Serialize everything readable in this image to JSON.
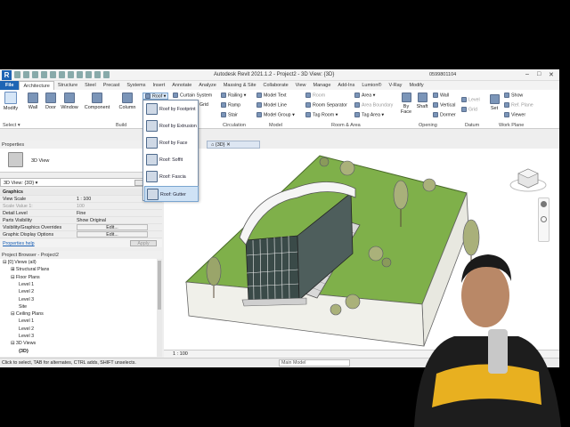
{
  "app": {
    "logo": "R",
    "title": "Autodesk Revit 2021.1.2 - Project2 - 3D View: {3D}",
    "user": "0599801104",
    "window_buttons": [
      "–",
      "□",
      "✕"
    ]
  },
  "tabs": [
    "File",
    "Architecture",
    "Structure",
    "Steel",
    "Precast",
    "Systems",
    "Insert",
    "Annotate",
    "Analyze",
    "Massing & Site",
    "Collaborate",
    "View",
    "Manage",
    "Add-Ins",
    "Lumion®",
    "V-Ray",
    "Modify"
  ],
  "active_tab": "Architecture",
  "ribbon": {
    "modify": "Modify",
    "select": "Select ▾",
    "build_buttons": [
      "Wall",
      "Door",
      "Window",
      "Component",
      "Column"
    ],
    "build_label": "Build",
    "roof": "Roof",
    "curtain_system": "Curtain System",
    "grid": "Grid",
    "railing": "Railing",
    "ramp": "Ramp",
    "stair": "Stair",
    "circulation_label": "Circulation",
    "model_text": "Model Text",
    "model_line": "Model Line",
    "model_group": "Model Group",
    "model_label": "Model",
    "room": "Room",
    "room_separator": "Room Separator",
    "tag_room": "Tag Room",
    "area": "Area",
    "area_boundary": "Area Boundary",
    "tag_area": "Tag Area",
    "room_area_label": "Room & Area",
    "by_face": "By\nFace",
    "shaft": "Shaft",
    "wall_opening": "Wall",
    "vertical": "Vertical",
    "dormer": "Dormer",
    "opening_label": "Opening",
    "level": "Level",
    "grid2": "Grid",
    "datum_label": "Datum",
    "set": "Set",
    "show": "Show",
    "ref_plane": "Ref. Plane",
    "viewer": "Viewer",
    "work_plane_label": "Work Plane"
  },
  "roof_menu": [
    "Roof by Footprint",
    "Roof by Extrusion",
    "Roof by Face",
    "Roof: Soffit",
    "Roof: Fascia",
    "Roof: Gutter"
  ],
  "properties": {
    "header": "Properties",
    "type_name": "3D View",
    "selector": "3D View: {3D}",
    "edit_type": "",
    "section": "Graphics",
    "rows": [
      {
        "k": "View Scale",
        "v": "1 : 100"
      },
      {
        "k": "Scale Value  1:",
        "v": "100"
      },
      {
        "k": "Detail Level",
        "v": "Fine"
      },
      {
        "k": "Parts Visibility",
        "v": "Show Original"
      },
      {
        "k": "Visibility/Graphics Overrides",
        "v": "Edit..."
      },
      {
        "k": "Graphic Display Options",
        "v": "Edit..."
      }
    ],
    "help_link": "Properties help",
    "apply": "Apply"
  },
  "browser": {
    "header": "Project Browser - Project2",
    "nodes": [
      {
        "t": "⊟ [0] Views (all)",
        "d": 0
      },
      {
        "t": "⊞ Structural Plans",
        "d": 1
      },
      {
        "t": "⊟ Floor Plans",
        "d": 1
      },
      {
        "t": "Level 1",
        "d": 2
      },
      {
        "t": "Level 2",
        "d": 2
      },
      {
        "t": "Level 3",
        "d": 2
      },
      {
        "t": "Site",
        "d": 2
      },
      {
        "t": "⊟ Ceiling Plans",
        "d": 1
      },
      {
        "t": "Level 1",
        "d": 2
      },
      {
        "t": "Level 2",
        "d": 2
      },
      {
        "t": "Level 3",
        "d": 2
      },
      {
        "t": "⊟ 3D Views",
        "d": 1
      },
      {
        "t": "{3D}",
        "d": 2
      }
    ]
  },
  "view": {
    "tab_label": "{3D}",
    "scale": "1 : 100"
  },
  "status": {
    "message": "Click to select, TAB for alternates, CTRL adds, SHIFT unselects.",
    "model": "Main Model"
  }
}
